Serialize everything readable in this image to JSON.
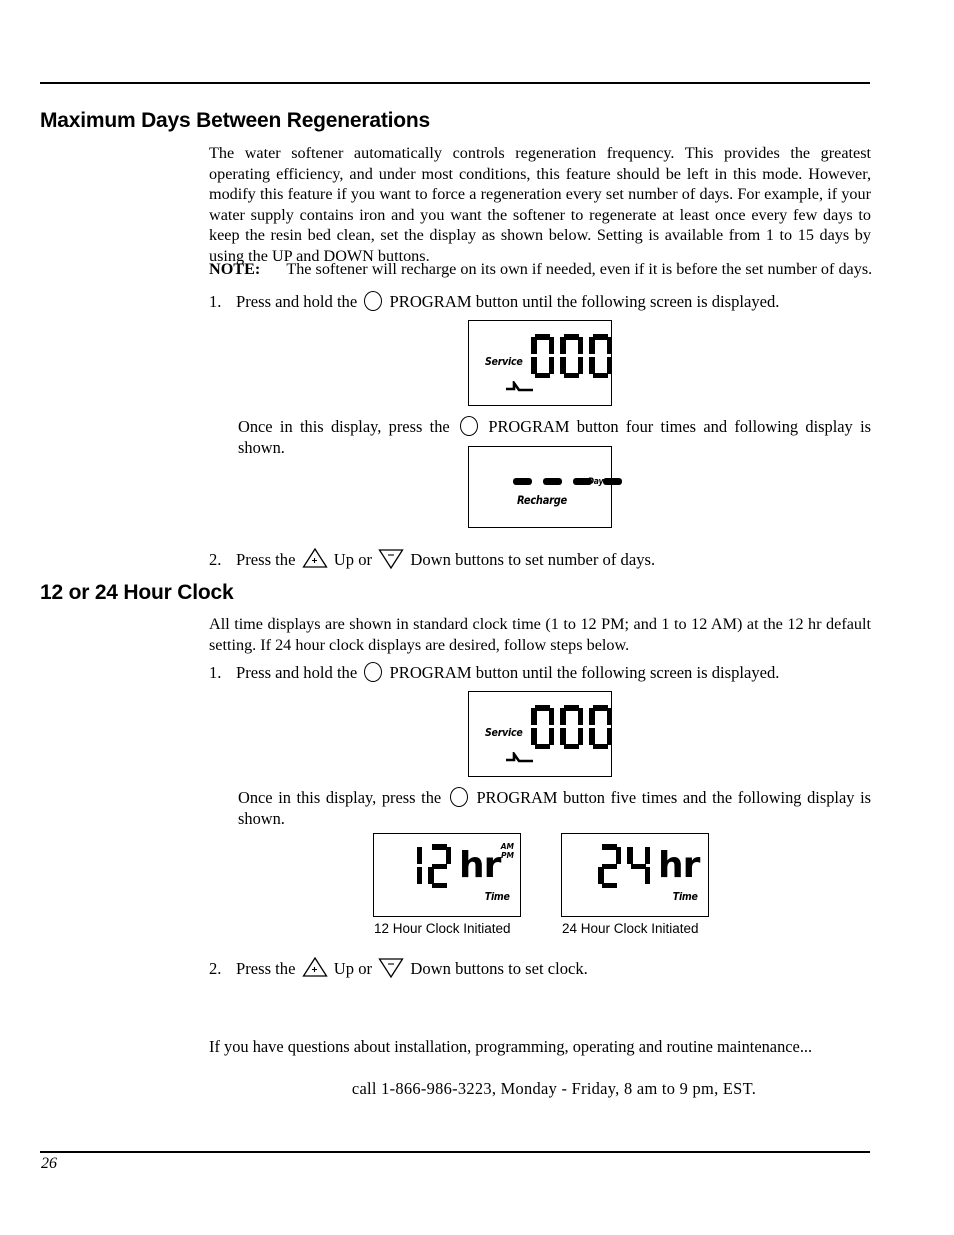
{
  "page": {
    "number": "26"
  },
  "sections": {
    "max_days": {
      "heading": "Maximum Days Between Regenerations",
      "paragraph": "The water softener automatically controls regeneration frequency. This provides the greatest operating efficiency, and under most conditions, this feature should be left in this mode.  However, modify this feature if you want to force a regeneration every set number of days. For example, if your water supply contains iron and you want the softener to regenerate at least once every few days to keep the resin bed clean, set the display as shown below. Setting is available from 1 to 15 days by using the UP and DOWN buttons.",
      "note_label": "NOTE:",
      "note_text": "The softener will recharge on its own if needed, even if it is before the set number of days.",
      "step1_num": "1.",
      "step1_text_before": "Press and hold the",
      "step1_text_after": "PROGRAM button until  the following screen is displayed.",
      "once_text_before": "Once in this display, press the",
      "once_text_after": "PROGRAM button four times and following display is shown.",
      "step2_num": "2.",
      "step2_text_before": "Press the",
      "step2_text_mid": "Up or",
      "step2_text_after": "Down buttons to set number of days."
    },
    "clock": {
      "heading": "12 or 24 Hour Clock",
      "paragraph": "All time displays are shown in standard clock time (1 to 12 PM; and 1 to 12 AM) at the 12 hr default setting. If 24 hour clock displays are desired, follow steps below.",
      "step1_num": "1.",
      "step1_text_before": "Press and hold the",
      "step1_text_after": "PROGRAM button until  the following screen is displayed.",
      "once_text_before": "Once in this display, press the",
      "once_text_after": "PROGRAM button five times and the following display is shown.",
      "step2_num": "2.",
      "step2_text_before": "Press the",
      "step2_text_mid": "Up or",
      "step2_text_after": "Down buttons to set clock.",
      "caption_12": "12 Hour Clock Initiated",
      "caption_24": "24 Hour Clock Initiated"
    }
  },
  "lcd": {
    "service_label": "Service",
    "service_value": "0 00",
    "recharge_label": "Recharge",
    "recharge_value": "- - - -",
    "day_label": "Day",
    "time_label": "Time",
    "am_label": "AM",
    "pm_label": "PM",
    "hr12_value": "12hr",
    "hr24_value": "24hr",
    "hr_suffix": "hr"
  },
  "closing": {
    "questions": "If you have questions about installation, programming, operating and routine maintenance...",
    "call": "call 1-866-986-3223, Monday - Friday, 8 am to 9 pm, EST."
  },
  "icons": {
    "program_button": "circle-program-button-icon",
    "up_button": "triangle-up-plus-icon",
    "down_button": "triangle-down-minus-icon",
    "service_faucet": "faucet-service-icon"
  }
}
